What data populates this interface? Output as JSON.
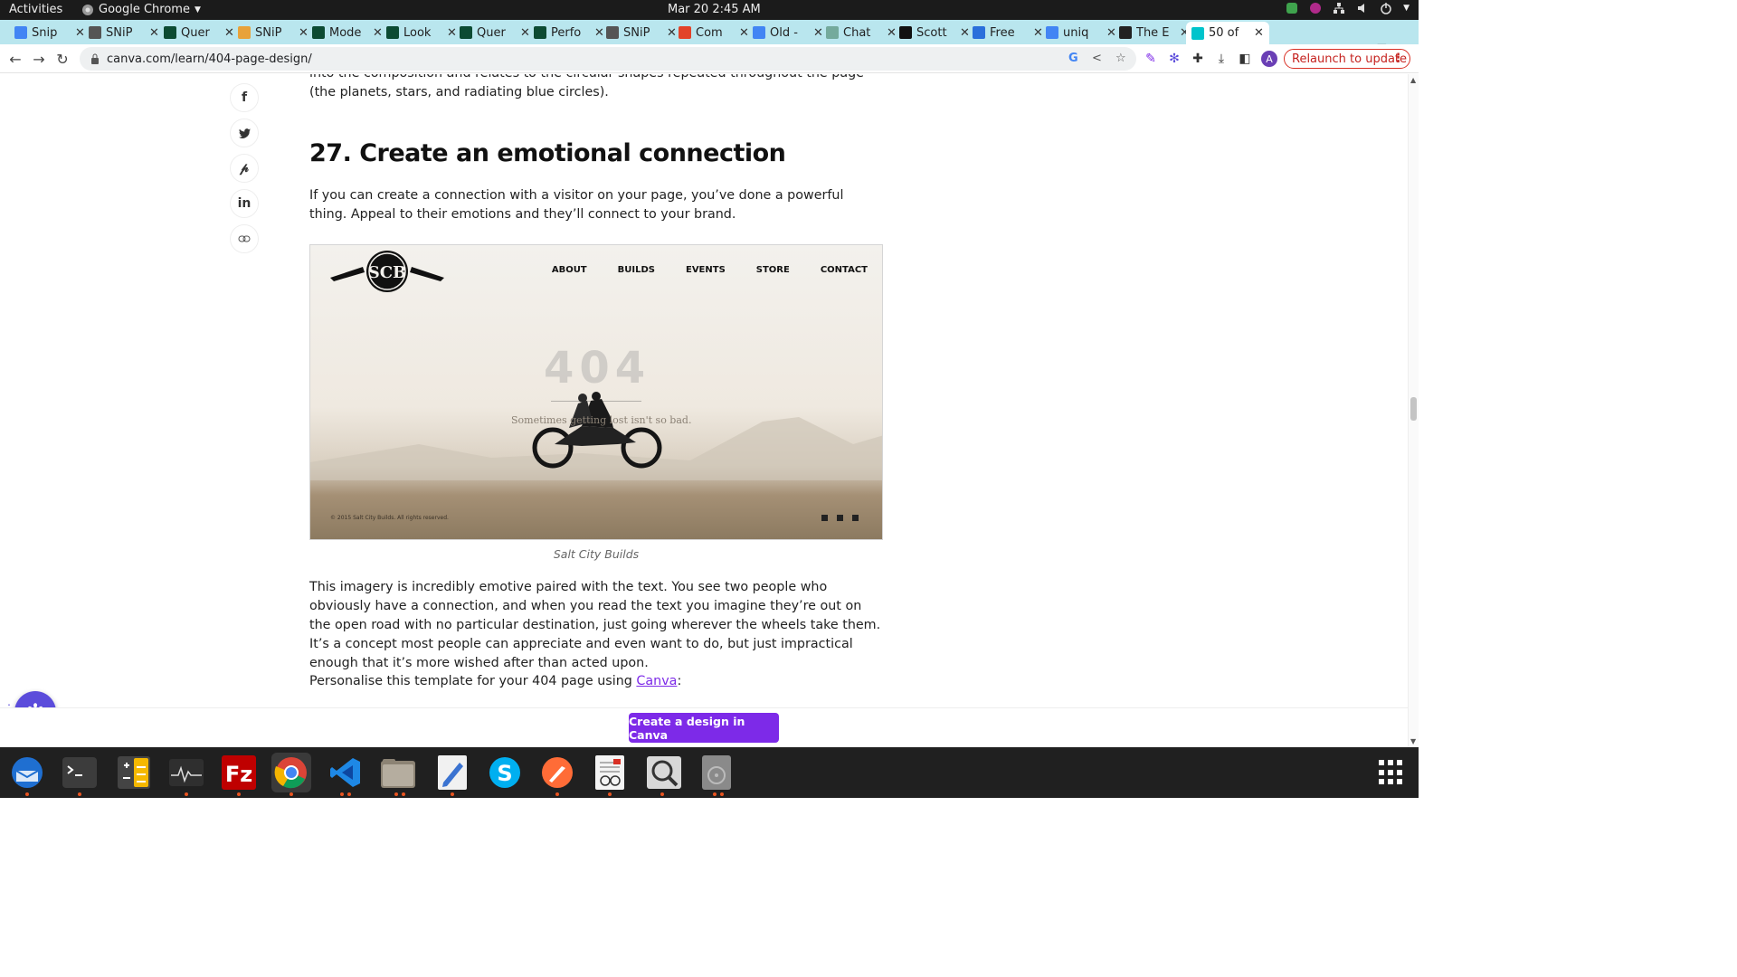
{
  "topbar": {
    "activities": "Activities",
    "app_name": "Google Chrome",
    "clock": "Mar 20  2:45 AM"
  },
  "tabs": [
    {
      "label": "Snip",
      "icon": "docs-icon",
      "color": "#4285f4"
    },
    {
      "label": "SNiP",
      "icon": "snip-icon",
      "color": "#555555"
    },
    {
      "label": "Quer",
      "icon": "django-icon",
      "color": "#0c4b33"
    },
    {
      "label": "SNiP",
      "icon": "chrome-ext-icon",
      "color": "#e8a23a"
    },
    {
      "label": "Mode",
      "icon": "django-icon",
      "color": "#0c4b33"
    },
    {
      "label": "Look",
      "icon": "django-icon",
      "color": "#0c4b33"
    },
    {
      "label": "Quer",
      "icon": "django-icon",
      "color": "#0c4b33"
    },
    {
      "label": "Perfo",
      "icon": "django-icon",
      "color": "#0c4b33"
    },
    {
      "label": "SNiP",
      "icon": "snip-icon",
      "color": "#555555"
    },
    {
      "label": "Com",
      "icon": "gitlab-icon",
      "color": "#e24329"
    },
    {
      "label": "Old -",
      "icon": "docs-icon",
      "color": "#4285f4"
    },
    {
      "label": "Chat",
      "icon": "openai-icon",
      "color": "#74aa9c"
    },
    {
      "label": "Scott",
      "icon": "s-icon",
      "color": "#111111"
    },
    {
      "label": "Free",
      "icon": "sql-icon",
      "color": "#2a6fdb"
    },
    {
      "label": "uniq",
      "icon": "google-icon",
      "color": "#4285f4"
    },
    {
      "label": "The E",
      "icon": "sej-icon",
      "color": "#222222"
    },
    {
      "label": "50 of",
      "icon": "canva-icon",
      "color": "#00c4cc",
      "active": true
    }
  ],
  "toolbar": {
    "url": "canva.com/learn/404-page-design/",
    "relaunch": "Relaunch to update",
    "avatar_letter": "A"
  },
  "share": [
    "facebook-icon",
    "twitter-icon",
    "pinterest-icon",
    "linkedin-icon",
    "link-icon"
  ],
  "article": {
    "top_paragraph": "into the composition and relates to the circular shapes repeated throughout the page (the planets, stars, and radiating blue circles).",
    "heading": "27. Create an emotional connection",
    "intro": "If you can create a connection with a visitor on your page, you’ve done a powerful thing. Appeal to their emotions and they’ll connect to your brand.",
    "caption": "Salt City Builds",
    "body": "This imagery is incredibly emotive paired with the text. You see two people who obviously have a connection, and when you read the text you imagine they’re out on the open road with no particular destination, just going wherever the wheels take them. It’s a concept most people can appreciate and even want to do, but just impractical enough that it’s more wished after than acted upon.",
    "personalise_prefix": "Personalise this template for your 404 page using ",
    "personalise_link": "Canva",
    "personalise_suffix": ":"
  },
  "screenshot": {
    "logo": "SCB",
    "nav": [
      "ABOUT",
      "BUILDS",
      "EVENTS",
      "STORE",
      "CONTACT"
    ],
    "big_404": "404",
    "message": "Sometimes getting lost isn't so bad.",
    "copyright": "© 2015 Salt City Builds. All rights reserved."
  },
  "cta": {
    "label": "Create a design in Canva"
  },
  "colors": {
    "accent": "#7d2ae8",
    "tabstrip": "#b9e6ee",
    "relaunch": "#d93025"
  },
  "dock": [
    "thunderbird-icon",
    "terminal-icon",
    "calculator-icon",
    "system-monitor-icon",
    "filezilla-icon",
    "chrome-icon",
    "vscode-icon",
    "files-icon",
    "text-editor-icon",
    "skype-icon",
    "postman-icon",
    "document-viewer-icon",
    "image-viewer-icon",
    "disk-icon"
  ]
}
